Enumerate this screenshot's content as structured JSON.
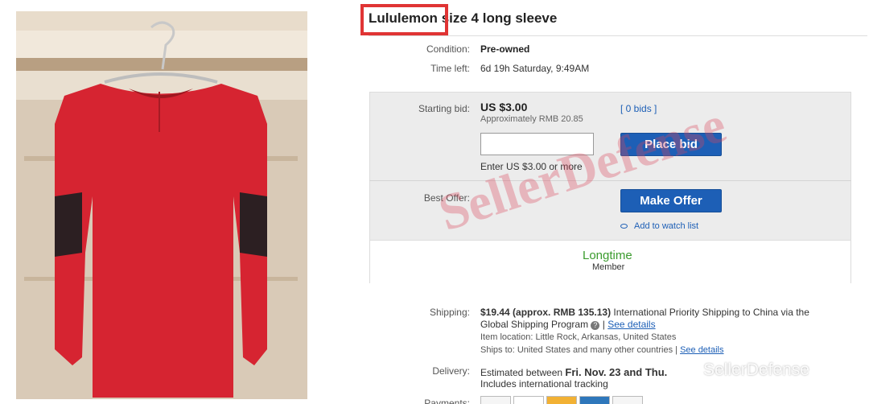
{
  "listing": {
    "title_brand": "Lululemon",
    "title_rest": "size 4 long sleeve",
    "condition_label": "Condition:",
    "condition_value": "Pre-owned",
    "timeleft_label": "Time left:",
    "timeleft_value": "6d 19h Saturday, 9:49AM"
  },
  "bid": {
    "starting_label": "Starting bid:",
    "price": "US $3.00",
    "approx": "Approximately RMB 20.85",
    "bids_link": "[ 0 bids ]",
    "input_value": "",
    "enter_hint": "Enter US $3.00 or more",
    "place_bid": "Place bid",
    "best_offer_label": "Best Offer:",
    "make_offer": "Make Offer",
    "watch_link": "Add to watch list"
  },
  "member": {
    "line1": "Longtime",
    "line2": "Member"
  },
  "shipping": {
    "label": "Shipping:",
    "price": "$19.44 (approx. RMB 135.13)",
    "method": "International Priority Shipping to China  via the",
    "program": "Global Shipping Program",
    "see_details": "See details",
    "location": "Item location:  Little Rock, Arkansas, United States",
    "ships_to": "Ships to:  United States and many other countries",
    "see_details2": "See details"
  },
  "delivery": {
    "label": "Delivery:",
    "text": "Estimated between",
    "dates": "Fri. Nov. 23 and Thu.",
    "intl": "Includes international tracking"
  },
  "payments": {
    "label": "Payments:"
  },
  "overlay": {
    "watermark": "SellerDefense",
    "wechat": "SellerDefense"
  },
  "colors": {
    "accent": "#1d5fb6",
    "highlight_box": "#e03434",
    "member_green": "#3a9b2d",
    "shirt": "#d62431"
  }
}
